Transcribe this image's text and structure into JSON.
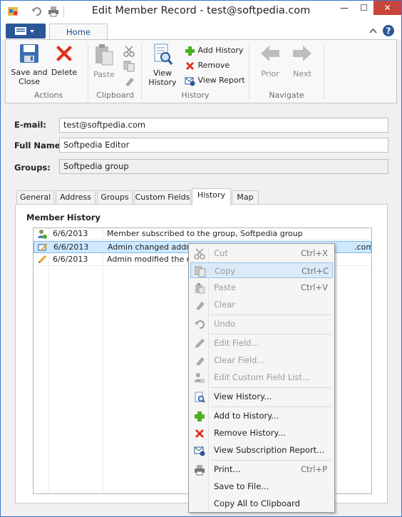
{
  "window": {
    "title": "Edit Member Record - test@softpedia.com"
  },
  "window_buttons": {
    "minimize": "—",
    "maximize": "☐",
    "close": "✕"
  },
  "ribbon_tabs": {
    "home": "Home"
  },
  "ribbon": {
    "actions": {
      "save_and_close": "Save and\nClose",
      "delete": "Delete",
      "group": "Actions"
    },
    "clipboard": {
      "paste": "Paste",
      "group": "Clipboard"
    },
    "history": {
      "view_history": "View\nHistory",
      "add_history": "Add History",
      "remove": "Remove",
      "view_report": "View Report",
      "group": "History"
    },
    "navigate": {
      "prior": "Prior",
      "next": "Next",
      "group": "Navigate"
    }
  },
  "fields": {
    "email_label": "E-mail:",
    "email_value": "test@softpedia.com",
    "fullname_label": "Full Name:",
    "fullname_value": "Softpedia Editor",
    "groups_label": "Groups:",
    "groups_value": "Softpedia group"
  },
  "content_tabs": [
    "General",
    "Address",
    "Groups",
    "Custom Fields",
    "History",
    "Map"
  ],
  "member_history": {
    "title": "Member History",
    "rows": [
      {
        "date": "6/6/2013",
        "desc": "Member subscribed to the group, Softpedia group"
      },
      {
        "date": "6/6/2013",
        "desc": "Admin changed address",
        "desc_tail": ".com"
      },
      {
        "date": "6/6/2013",
        "desc": "Admin modified the mem"
      }
    ]
  },
  "context_menu": {
    "cut": "Cut",
    "cut_key": "Ctrl+X",
    "copy": "Copy",
    "copy_key": "Ctrl+C",
    "paste": "Paste",
    "paste_key": "Ctrl+V",
    "clear": "Clear",
    "undo": "Undo",
    "edit_field": "Edit Field...",
    "clear_field": "Clear Field...",
    "edit_custom": "Edit Custom Field List...",
    "view_history": "View History...",
    "add_history": "Add to History...",
    "remove_history": "Remove History...",
    "view_report": "View Subscription Report...",
    "print": "Print...",
    "print_key": "Ctrl+P",
    "save_file": "Save to File...",
    "copy_all": "Copy All to Clipboard"
  },
  "colors": {
    "accent": "#2b5797",
    "close": "#c7463b",
    "selection": "#cde8ff",
    "add": "#4caf1f",
    "remove": "#e0301e"
  }
}
